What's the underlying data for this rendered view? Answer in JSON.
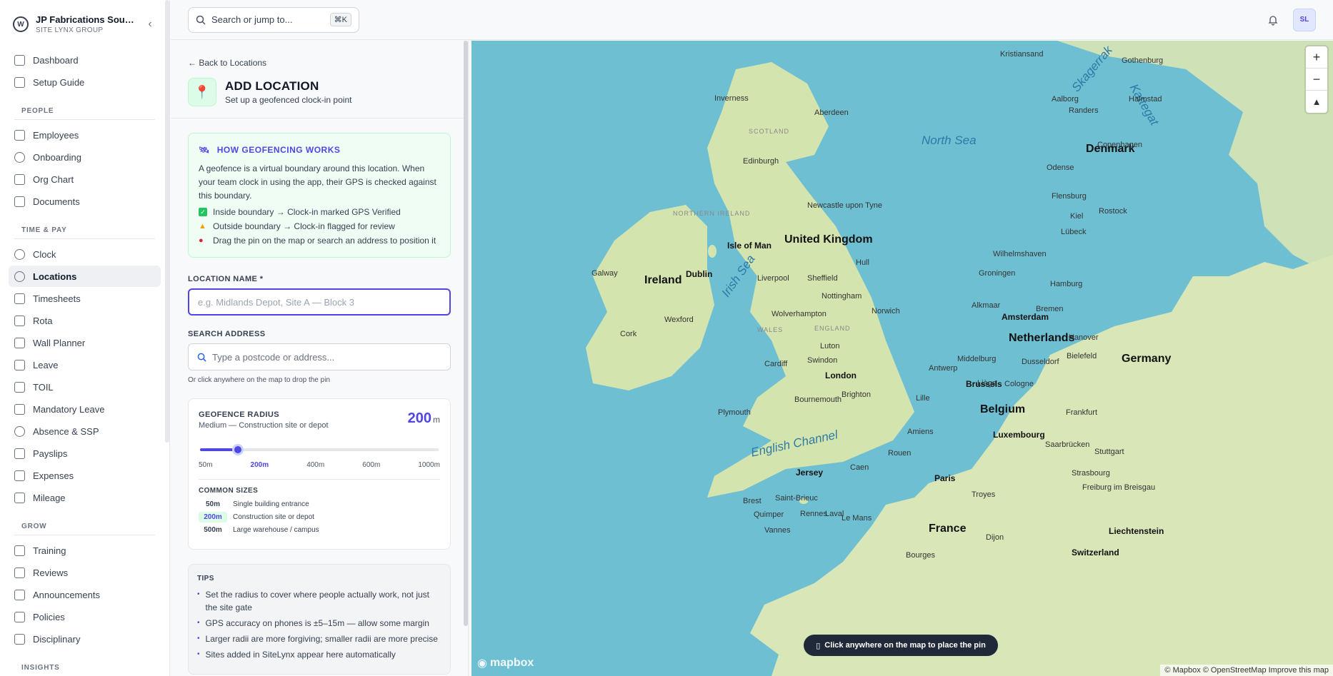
{
  "sidebar": {
    "org_name": "JP Fabrications Sou…",
    "org_group": "SITE LYNX GROUP",
    "top_items": [
      {
        "label": "Dashboard"
      },
      {
        "label": "Setup Guide"
      }
    ],
    "sections": [
      {
        "title": "PEOPLE",
        "items": [
          {
            "label": "Employees"
          },
          {
            "label": "Onboarding"
          },
          {
            "label": "Org Chart"
          },
          {
            "label": "Documents"
          }
        ]
      },
      {
        "title": "TIME & PAY",
        "items": [
          {
            "label": "Clock"
          },
          {
            "label": "Locations",
            "active": true
          },
          {
            "label": "Timesheets"
          },
          {
            "label": "Rota"
          },
          {
            "label": "Wall Planner"
          },
          {
            "label": "Leave"
          },
          {
            "label": "TOIL"
          },
          {
            "label": "Mandatory Leave"
          },
          {
            "label": "Absence & SSP"
          },
          {
            "label": "Payslips"
          },
          {
            "label": "Expenses"
          },
          {
            "label": "Mileage"
          }
        ]
      },
      {
        "title": "GROW",
        "items": [
          {
            "label": "Training"
          },
          {
            "label": "Reviews"
          },
          {
            "label": "Announcements"
          },
          {
            "label": "Policies"
          },
          {
            "label": "Disciplinary"
          }
        ]
      },
      {
        "title": "INSIGHTS",
        "items": []
      }
    ]
  },
  "topbar": {
    "search_placeholder": "Search or jump to...",
    "shortcut": "⌘K",
    "avatar_initials": "SL"
  },
  "form": {
    "back_link": "← Back to Locations",
    "title": "ADD LOCATION",
    "subtitle": "Set up a geofenced clock-in point",
    "info": {
      "title": "HOW GEOFENCING WORKS",
      "text": "A geofence is a virtual boundary around this location. When your team clock in using the app, their GPS is checked against this boundary.",
      "rows": [
        "Inside boundary → Clock-in marked GPS Verified",
        "Outside boundary → Clock-in flagged for review",
        "Drag the pin on the map or search an address to position it"
      ]
    },
    "location_name_label": "LOCATION NAME *",
    "location_name_placeholder": "e.g. Midlands Depot, Site A — Block 3",
    "search_address_label": "SEARCH ADDRESS",
    "search_address_placeholder": "Type a postcode or address...",
    "map_hint": "Or click anywhere on the map to drop the pin",
    "radius": {
      "label": "GEOFENCE RADIUS",
      "description": "Medium — Construction site or depot",
      "value": "200",
      "unit": "m",
      "slider_fraction": 0.16,
      "ticks": [
        "50m",
        "200m",
        "400m",
        "600m",
        "1000m"
      ],
      "common_title": "COMMON SIZES",
      "common": [
        {
          "size": "50m",
          "desc": "Single building entrance"
        },
        {
          "size": "200m",
          "desc": "Construction site or depot",
          "selected": true
        },
        {
          "size": "500m",
          "desc": "Large warehouse / campus"
        }
      ]
    },
    "tips": {
      "title": "TIPS",
      "items": [
        "Set the radius to cover where people actually work, not just the site gate",
        "GPS accuracy on phones is ±5–15m — allow some margin",
        "Larger radii are more forgiving; smaller radii are more precise",
        "Sites added in SiteLynx appear here automatically"
      ]
    }
  },
  "map": {
    "toast": "Click anywhere on the map to place the pin",
    "attribution": "© Mapbox © OpenStreetMap Improve this map",
    "logo": "mapbox",
    "zoom_in": "+",
    "zoom_out": "−",
    "compass": "▲",
    "labels": {
      "north_sea": "North Sea",
      "irish_sea": "Irish Sea",
      "english_channel": "English Channel",
      "skagerrak": "Skagerrak",
      "kattegat": "Kattegat",
      "united_kingdom": "United Kingdom",
      "ireland": "Ireland",
      "france": "France",
      "belgium": "Belgium",
      "netherlands": "Netherlands",
      "germany": "Germany",
      "denmark": "Denmark",
      "luxembourg": "Luxembourg",
      "switzerland": "Switzerland",
      "liechtenstein": "Liechtenstein",
      "jersey": "Jersey",
      "isle_of_man": "Isle of Man",
      "scotland": "SCOTLAND",
      "wales": "WALES",
      "england": "ENGLAND",
      "northern_ireland": "NORTHERN IRELAND",
      "london": "London",
      "paris": "Paris",
      "dublin": "Dublin",
      "brussels": "Brussels",
      "amsterdam": "Amsterdam",
      "edinburgh": "Edinburgh",
      "cities": [
        "Inverness",
        "Aberdeen",
        "Newcastle upon Tyne",
        "Hull",
        "Liverpool",
        "Sheffield",
        "Nottingham",
        "Norwich",
        "Wolverhampton",
        "Luton",
        "Cardiff",
        "Swindon",
        "Bournemouth",
        "Brighton",
        "Plymouth",
        "Galway",
        "Cork",
        "Wexford",
        "Caen",
        "Rouen",
        "Amiens",
        "Lille",
        "Antwerp",
        "Middelburg",
        "Liège",
        "Cologne",
        "Dusseldorf",
        "Bielefeld",
        "Hanover",
        "Bremen",
        "Hamburg",
        "Kiel",
        "Lübeck",
        "Rostock",
        "Odense",
        "Copenhagen",
        "Aalborg",
        "Randers",
        "Flensburg",
        "Groningen",
        "Wilhelmshaven",
        "Alkmaar",
        "Frankfurt",
        "Stuttgart",
        "Strasbourg",
        "Saarbrücken",
        "Troyes",
        "Dijon",
        "Freiburg im Breisgau",
        "Brest",
        "Quimper",
        "Saint-Brieuc",
        "Rennes",
        "Laval",
        "Le Mans",
        "Vannes",
        "Bourges",
        "Kristiansand",
        "Gothenburg",
        "Halmstad"
      ]
    }
  }
}
